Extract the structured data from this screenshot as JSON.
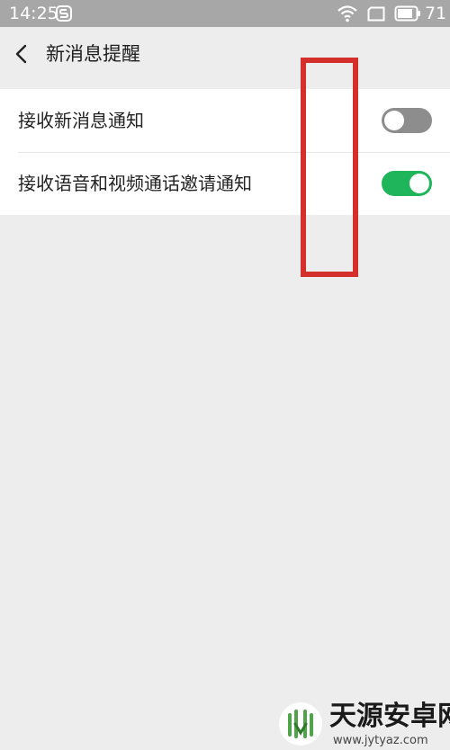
{
  "status_bar": {
    "time": "14:25",
    "app_icon": "s-app-icon",
    "wifi_icon": "wifi-icon",
    "screen_icon": "screen-rotate-icon",
    "battery_icon": "battery-icon",
    "battery_level": "71"
  },
  "header": {
    "back_icon": "chevron-left-icon",
    "title": "新消息提醒"
  },
  "settings": [
    {
      "label": "接收新消息通知",
      "enabled": false
    },
    {
      "label": "接收语音和视频通话邀请通知",
      "enabled": true
    }
  ],
  "colors": {
    "toggle_on": "#1fb55a",
    "toggle_off": "#8d8d8d",
    "highlight": "#d42f2b"
  },
  "watermark": {
    "title": "天源安卓网",
    "url": "www.jytyaz.com"
  }
}
